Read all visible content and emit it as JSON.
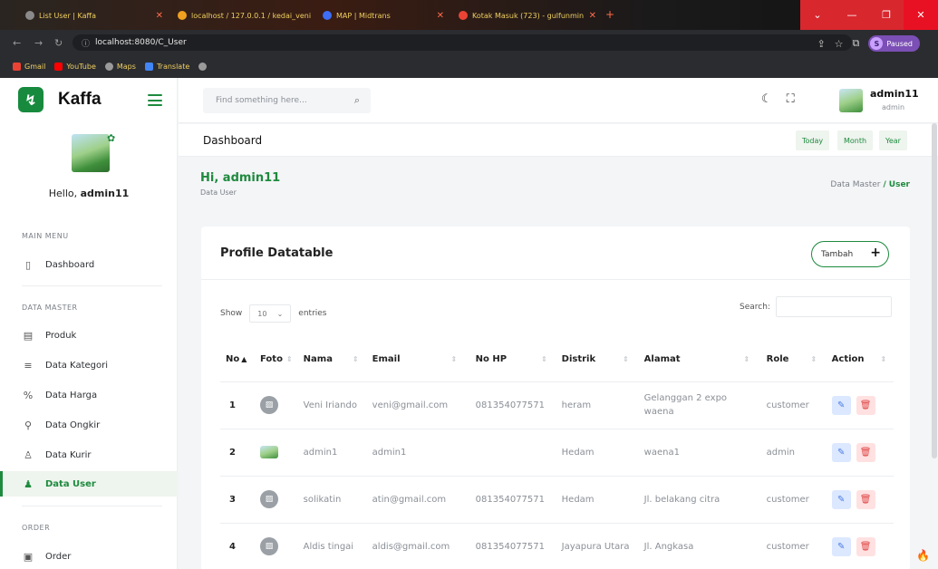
{
  "browser": {
    "tabs": [
      {
        "label": "List User | Kaffa"
      },
      {
        "label": "localhost / 127.0.0.1 / kedai_veni"
      },
      {
        "label": "MAP | Midtrans"
      },
      {
        "label": "Kotak Masuk (723) - gulfunmin"
      }
    ],
    "url": "localhost:8080/C_User",
    "profile_letter": "S",
    "profile_status": "Paused",
    "bookmarks": [
      "Gmail",
      "YouTube",
      "Maps",
      "Translate"
    ]
  },
  "app": {
    "brand": "Kaffa",
    "search_placeholder": "Find something here...",
    "user": {
      "name": "admin11",
      "role": "admin"
    },
    "greeting_prefix": "Hello, ",
    "greeting_name": "admin11"
  },
  "sidebar": {
    "sections": {
      "main": "MAIN MENU",
      "master": "DATA MASTER",
      "order": "ORDER"
    },
    "items": [
      {
        "label": "Dashboard"
      },
      {
        "label": "Produk"
      },
      {
        "label": "Data Kategori"
      },
      {
        "label": "Data Harga"
      },
      {
        "label": "Data Ongkir"
      },
      {
        "label": "Data Kurir"
      },
      {
        "label": "Data User"
      },
      {
        "label": "Order"
      }
    ]
  },
  "page": {
    "title": "Dashboard",
    "periods": [
      "Today",
      "Month",
      "Year"
    ],
    "hi": "Hi, admin11",
    "subtitle": "Data User",
    "breadcrumb": {
      "parent": "Data Master",
      "sep": "/",
      "current": "User"
    }
  },
  "card": {
    "title": "Profile Datatable",
    "add_button": "Tambah",
    "show_label": "Show",
    "entries_value": "10",
    "entries_label": "entries",
    "search_label": "Search:",
    "columns": [
      "No",
      "Foto",
      "Nama",
      "Email",
      "No HP",
      "Distrik",
      "Alamat",
      "Role",
      "Action"
    ],
    "rows": [
      {
        "no": "1",
        "nama": "Veni Iriando",
        "email": "veni@gmail.com",
        "hp": "081354077571",
        "distrik": "heram",
        "alamat": "Gelanggan 2 expo waena",
        "role": "customer"
      },
      {
        "no": "2",
        "nama": "admin1",
        "email": "admin1",
        "hp": "",
        "distrik": "Hedam",
        "alamat": "waena1",
        "role": "admin"
      },
      {
        "no": "3",
        "nama": "solikatin",
        "email": "atin@gmail.com",
        "hp": "081354077571",
        "distrik": "Hedam",
        "alamat": "Jl. belakang citra",
        "role": "customer"
      },
      {
        "no": "4",
        "nama": "Aldis tingai",
        "email": "aldis@gmail.com",
        "hp": "081354077571",
        "distrik": "Jayapura Utara",
        "alamat": "Jl. Angkasa",
        "role": "customer"
      }
    ]
  }
}
